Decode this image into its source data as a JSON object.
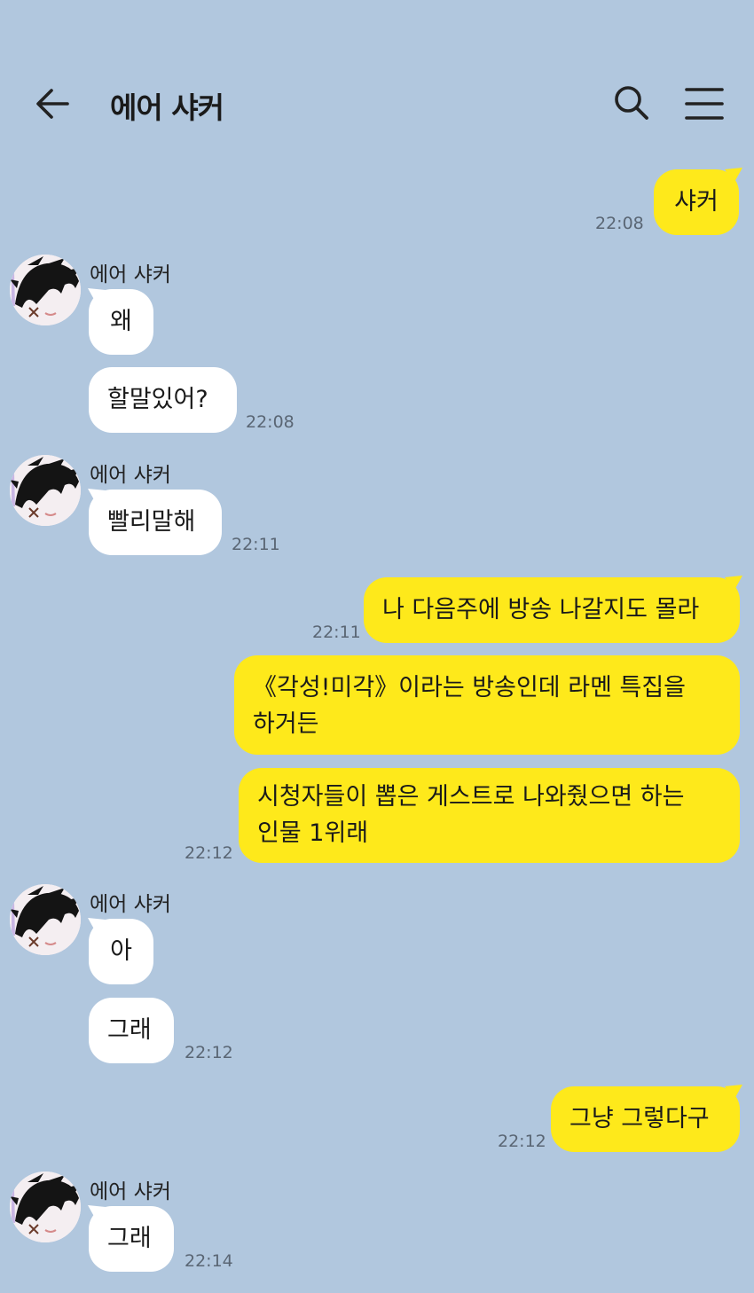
{
  "header": {
    "title": "에어 샤커",
    "back_icon": "arrow-left-icon",
    "search_icon": "search-icon",
    "menu_icon": "hamburger-menu-icon"
  },
  "colors": {
    "background": "#b1c7de",
    "mine_bubble": "#fee91b",
    "their_bubble": "#ffffff"
  },
  "messages": [
    {
      "sender": "me",
      "text": "샤커",
      "time": "22:08"
    },
    {
      "sender": "에어 샤커",
      "text": "왜"
    },
    {
      "sender": "에어 샤커",
      "text": "할말있어?",
      "time": "22:08"
    },
    {
      "sender": "에어 샤커",
      "text": "빨리말해",
      "time": "22:11"
    },
    {
      "sender": "me",
      "text": "나 다음주에 방송 나갈지도 몰라",
      "time": "22:11"
    },
    {
      "sender": "me",
      "lines": [
        "《각성!미각》이라는 방송인데 라멘 특집을",
        "하거든"
      ]
    },
    {
      "sender": "me",
      "lines": [
        "시청자들이 뽑은 게스트로 나와줬으면 하는",
        "인물 1위래"
      ],
      "time": "22:12"
    },
    {
      "sender": "에어 샤커",
      "text": "아"
    },
    {
      "sender": "에어 샤커",
      "text": "그래",
      "time": "22:12"
    },
    {
      "sender": "me",
      "text": "그냥 그렇다구",
      "time": "22:12"
    },
    {
      "sender": "에어 샤커",
      "text": "그래",
      "time": "22:14"
    }
  ]
}
